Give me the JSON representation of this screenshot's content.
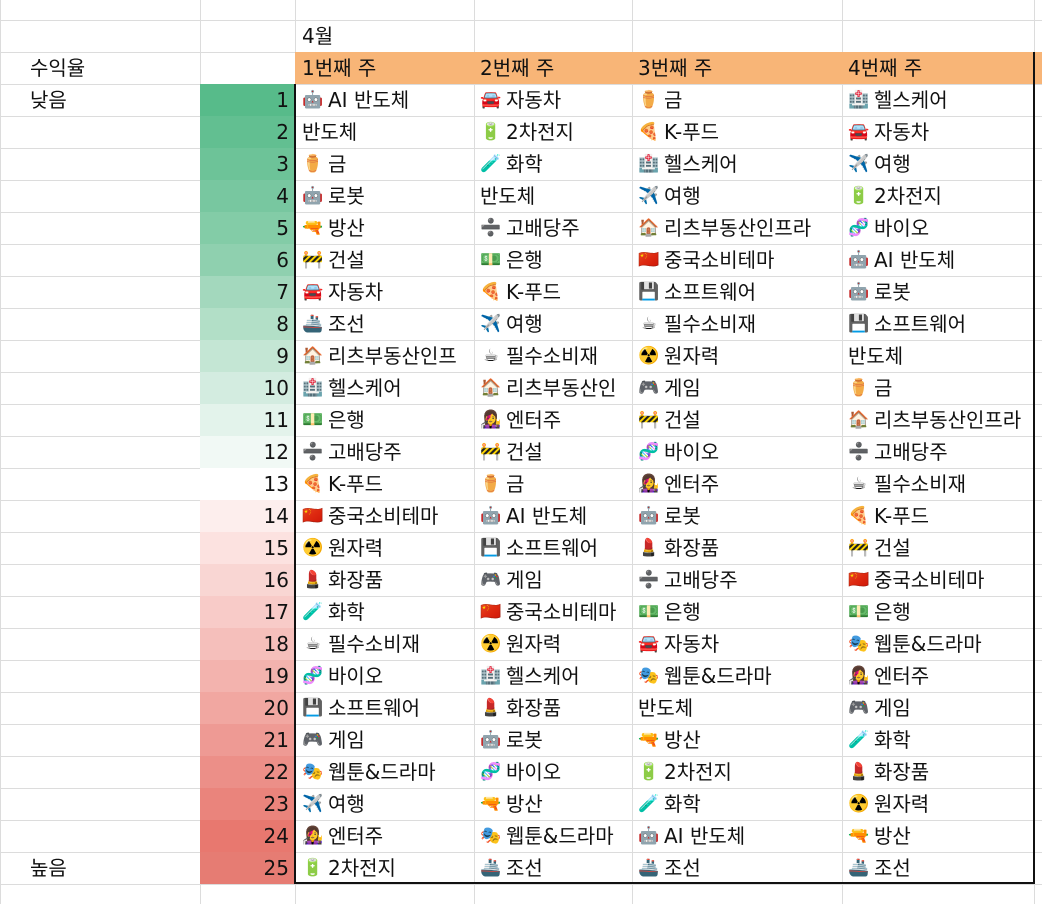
{
  "sheet": {
    "month": "4월",
    "label_header": "수익율",
    "label_low": "낮음",
    "label_high": "높음",
    "weeks": [
      "1번째 주",
      "2번째 주",
      "3번째 주",
      "4번째 주"
    ],
    "rank_colors": [
      "#57bb8a",
      "#62bf91",
      "#6dc398",
      "#78c7a0",
      "#83cca7",
      "#8fd0af",
      "#a3d8bd",
      "#b2dfc7",
      "#c4e6d4",
      "#d3ece0",
      "#e3f3eb",
      "#f1f9f5",
      "#ffffff",
      "#fdeeed",
      "#fce2e0",
      "#f9d6d3",
      "#f8cbc8",
      "#f5bfbb",
      "#f3b3ae",
      "#f1a7a1",
      "#ee9a94",
      "#ec8f88",
      "#ea847c",
      "#e8786f",
      "#e67c73"
    ],
    "rows": [
      {
        "rank": "1",
        "cells": [
          {
            "icon": "🤖",
            "text": "AI 반도체"
          },
          {
            "icon": "🚘",
            "text": "자동차"
          },
          {
            "icon": "⚱️",
            "text": "금"
          },
          {
            "icon": "🏥",
            "text": "헬스케어"
          }
        ]
      },
      {
        "rank": "2",
        "cells": [
          {
            "icon": "",
            "text": "반도체"
          },
          {
            "icon": "🔋",
            "text": "2차전지"
          },
          {
            "icon": "🍕",
            "text": "K-푸드"
          },
          {
            "icon": "🚘",
            "text": "자동차"
          }
        ]
      },
      {
        "rank": "3",
        "cells": [
          {
            "icon": "⚱️",
            "text": "금"
          },
          {
            "icon": "🧪",
            "text": "화학"
          },
          {
            "icon": "🏥",
            "text": "헬스케어"
          },
          {
            "icon": "✈️",
            "text": "여행"
          }
        ]
      },
      {
        "rank": "4",
        "cells": [
          {
            "icon": "🤖",
            "text": "로봇"
          },
          {
            "icon": "",
            "text": "반도체"
          },
          {
            "icon": "✈️",
            "text": "여행"
          },
          {
            "icon": "🔋",
            "text": "2차전지"
          }
        ]
      },
      {
        "rank": "5",
        "cells": [
          {
            "icon": "🔫",
            "text": "방산"
          },
          {
            "icon": "➗",
            "text": "고배당주"
          },
          {
            "icon": "🏠",
            "text": "리츠부동산인프라"
          },
          {
            "icon": "🧬",
            "text": "바이오"
          }
        ]
      },
      {
        "rank": "6",
        "cells": [
          {
            "icon": "🚧",
            "text": "건설"
          },
          {
            "icon": "💵",
            "text": "은행"
          },
          {
            "icon": "🇨🇳",
            "text": "중국소비테마"
          },
          {
            "icon": "🤖",
            "text": "AI 반도체"
          }
        ]
      },
      {
        "rank": "7",
        "cells": [
          {
            "icon": "🚘",
            "text": "자동차"
          },
          {
            "icon": "🍕",
            "text": "K-푸드"
          },
          {
            "icon": "💾",
            "text": "소프트웨어"
          },
          {
            "icon": "🤖",
            "text": "로봇"
          }
        ]
      },
      {
        "rank": "8",
        "cells": [
          {
            "icon": "🚢",
            "text": "조선"
          },
          {
            "icon": "✈️",
            "text": "여행"
          },
          {
            "icon": "☕",
            "text": "필수소비재"
          },
          {
            "icon": "💾",
            "text": "소프트웨어"
          }
        ]
      },
      {
        "rank": "9",
        "cells": [
          {
            "icon": "🏠",
            "text": "리츠부동산인프"
          },
          {
            "icon": "☕",
            "text": "필수소비재"
          },
          {
            "icon": "☢️",
            "text": "원자력"
          },
          {
            "icon": "",
            "text": "반도체"
          }
        ]
      },
      {
        "rank": "10",
        "cells": [
          {
            "icon": "🏥",
            "text": "헬스케어"
          },
          {
            "icon": "🏠",
            "text": "리츠부동산인"
          },
          {
            "icon": "🎮",
            "text": "게임"
          },
          {
            "icon": "⚱️",
            "text": "금"
          }
        ]
      },
      {
        "rank": "11",
        "cells": [
          {
            "icon": "💵",
            "text": "은행"
          },
          {
            "icon": "👩‍🎤",
            "text": "엔터주"
          },
          {
            "icon": "🚧",
            "text": "건설"
          },
          {
            "icon": "🏠",
            "text": "리츠부동산인프라"
          }
        ]
      },
      {
        "rank": "12",
        "cells": [
          {
            "icon": "➗",
            "text": "고배당주"
          },
          {
            "icon": "🚧",
            "text": "건설"
          },
          {
            "icon": "🧬",
            "text": "바이오"
          },
          {
            "icon": "➗",
            "text": "고배당주"
          }
        ]
      },
      {
        "rank": "13",
        "cells": [
          {
            "icon": "🍕",
            "text": "K-푸드"
          },
          {
            "icon": "⚱️",
            "text": "금"
          },
          {
            "icon": "👩‍🎤",
            "text": "엔터주"
          },
          {
            "icon": "☕",
            "text": "필수소비재"
          }
        ]
      },
      {
        "rank": "14",
        "cells": [
          {
            "icon": "🇨🇳",
            "text": "중국소비테마"
          },
          {
            "icon": "🤖",
            "text": "AI 반도체"
          },
          {
            "icon": "🤖",
            "text": "로봇"
          },
          {
            "icon": "🍕",
            "text": "K-푸드"
          }
        ]
      },
      {
        "rank": "15",
        "cells": [
          {
            "icon": "☢️",
            "text": "원자력"
          },
          {
            "icon": "💾",
            "text": "소프트웨어"
          },
          {
            "icon": "💄",
            "text": "화장품"
          },
          {
            "icon": "🚧",
            "text": "건설"
          }
        ]
      },
      {
        "rank": "16",
        "cells": [
          {
            "icon": "💄",
            "text": "화장품"
          },
          {
            "icon": "🎮",
            "text": "게임"
          },
          {
            "icon": "➗",
            "text": "고배당주"
          },
          {
            "icon": "🇨🇳",
            "text": "중국소비테마"
          }
        ]
      },
      {
        "rank": "17",
        "cells": [
          {
            "icon": "🧪",
            "text": "화학"
          },
          {
            "icon": "🇨🇳",
            "text": "중국소비테마"
          },
          {
            "icon": "💵",
            "text": "은행"
          },
          {
            "icon": "💵",
            "text": "은행"
          }
        ]
      },
      {
        "rank": "18",
        "cells": [
          {
            "icon": "☕",
            "text": "필수소비재"
          },
          {
            "icon": "☢️",
            "text": "원자력"
          },
          {
            "icon": "🚘",
            "text": "자동차"
          },
          {
            "icon": "🎭",
            "text": "웹툰&드라마"
          }
        ]
      },
      {
        "rank": "19",
        "cells": [
          {
            "icon": "🧬",
            "text": "바이오"
          },
          {
            "icon": "🏥",
            "text": "헬스케어"
          },
          {
            "icon": "🎭",
            "text": "웹툰&드라마"
          },
          {
            "icon": "👩‍🎤",
            "text": "엔터주"
          }
        ]
      },
      {
        "rank": "20",
        "cells": [
          {
            "icon": "💾",
            "text": "소프트웨어"
          },
          {
            "icon": "💄",
            "text": "화장품"
          },
          {
            "icon": "",
            "text": "반도체"
          },
          {
            "icon": "🎮",
            "text": "게임"
          }
        ]
      },
      {
        "rank": "21",
        "cells": [
          {
            "icon": "🎮",
            "text": "게임"
          },
          {
            "icon": "🤖",
            "text": "로봇"
          },
          {
            "icon": "🔫",
            "text": "방산"
          },
          {
            "icon": "🧪",
            "text": "화학"
          }
        ]
      },
      {
        "rank": "22",
        "cells": [
          {
            "icon": "🎭",
            "text": "웹툰&드라마"
          },
          {
            "icon": "🧬",
            "text": "바이오"
          },
          {
            "icon": "🔋",
            "text": "2차전지"
          },
          {
            "icon": "💄",
            "text": "화장품"
          }
        ]
      },
      {
        "rank": "23",
        "cells": [
          {
            "icon": "✈️",
            "text": "여행"
          },
          {
            "icon": "🔫",
            "text": "방산"
          },
          {
            "icon": "🧪",
            "text": "화학"
          },
          {
            "icon": "☢️",
            "text": "원자력"
          }
        ]
      },
      {
        "rank": "24",
        "cells": [
          {
            "icon": "👩‍🎤",
            "text": "엔터주"
          },
          {
            "icon": "🎭",
            "text": "웹툰&드라마"
          },
          {
            "icon": "🤖",
            "text": "AI 반도체"
          },
          {
            "icon": "🔫",
            "text": "방산"
          }
        ]
      },
      {
        "rank": "25",
        "cells": [
          {
            "icon": "🔋",
            "text": "2차전지"
          },
          {
            "icon": "🚢",
            "text": "조선"
          },
          {
            "icon": "🚢",
            "text": "조선"
          },
          {
            "icon": "🚢",
            "text": "조선"
          }
        ]
      }
    ]
  }
}
